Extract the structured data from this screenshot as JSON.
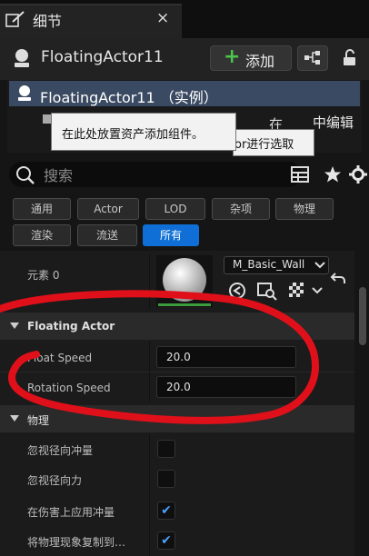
{
  "panel": {
    "tab_title": "细节",
    "tab_close": "×"
  },
  "actor": {
    "name": "FloatingActor11",
    "add_label": "添加"
  },
  "tree": {
    "selected": "FloatingActor11 （实例）",
    "row2": "中编辑",
    "row2_prefix": "在"
  },
  "tooltips": {
    "tip1": "在此处放置资产添加组件。",
    "tip2": "or进行选取"
  },
  "search": {
    "placeholder": "搜索"
  },
  "filters": [
    {
      "label": "通用",
      "active": false
    },
    {
      "label": "Actor",
      "active": false
    },
    {
      "label": "LOD",
      "active": false
    },
    {
      "label": "杂项",
      "active": false
    },
    {
      "label": "物理",
      "active": false
    },
    {
      "label": "渲染",
      "active": false
    },
    {
      "label": "流送",
      "active": false
    },
    {
      "label": "所有",
      "active": true
    }
  ],
  "material": {
    "element_label": "元素 0",
    "name": "M_Basic_Wall"
  },
  "floating_actor": {
    "title": "Floating Actor",
    "float_speed_label": "Float Speed",
    "float_speed_value": "20.0",
    "rotation_speed_label": "Rotation Speed",
    "rotation_speed_value": "20.0"
  },
  "physics": {
    "title": "物理",
    "rows": [
      {
        "label": "忽视径向冲量",
        "checked": false
      },
      {
        "label": "忽视径向力",
        "checked": false
      },
      {
        "label": "在伤害上应用冲量",
        "checked": true
      },
      {
        "label": "将物理现象复制到…",
        "checked": true
      }
    ]
  },
  "colors": {
    "accent": "#0f6fd6",
    "highlight": "#3a4a62",
    "annotation": "#e0101a"
  }
}
